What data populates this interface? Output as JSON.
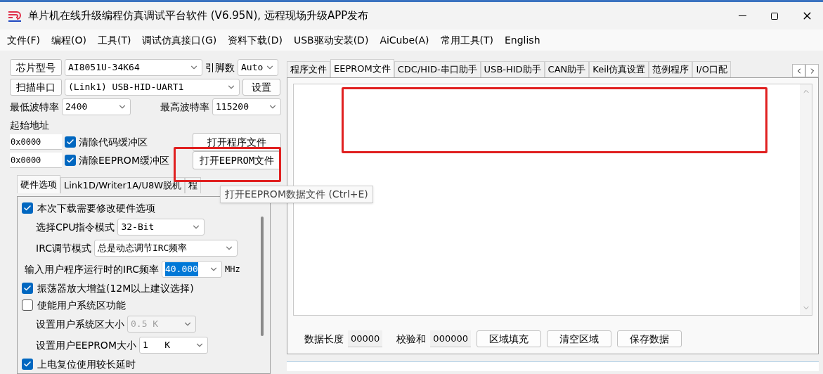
{
  "window": {
    "title": "单片机在线升级编程仿真调试平台软件 (V6.95N), 远程现场升级APP发布"
  },
  "menu": [
    "文件(F)",
    "编程(O)",
    "工具(T)",
    "调试仿真接口(G)",
    "资料下载(D)",
    "USB驱动安装(D)",
    "AiCube(A)",
    "常用工具(T)",
    "English"
  ],
  "chip": {
    "button": "芯片型号",
    "value": "AI8051U-34K64",
    "pins_label": "引脚数",
    "pins_value": "Auto"
  },
  "port": {
    "button": "扫描串口",
    "value": "(Link1) USB-HID-UART1",
    "settings_button": "设置"
  },
  "baud": {
    "min_label": "最低波特率",
    "min_value": "2400",
    "max_label": "最高波特率",
    "max_value": "115200"
  },
  "address": {
    "label": "起始地址",
    "rows": [
      {
        "value": "0x0000",
        "checkbox_label": "清除代码缓冲区",
        "checked": true,
        "button": "打开程序文件"
      },
      {
        "value": "0x0000",
        "checkbox_label": "清除EEPROM缓冲区",
        "checked": true,
        "button": "打开EEPROM文件"
      }
    ]
  },
  "left_tabs": [
    {
      "label": "硬件选项",
      "selected": true
    },
    {
      "label": "Link1D/Writer1A/U8W脱机",
      "selected": false
    },
    {
      "label": "程",
      "selected": false
    }
  ],
  "tooltip": "打开EEPROM数据文件 (Ctrl+E)",
  "hardware_options": [
    {
      "kind": "checkbox",
      "label": "本次下载需要修改硬件选项",
      "checked": true
    },
    {
      "kind": "select",
      "label": "选择CPU指令模式",
      "value": "32-Bit",
      "disabled": false
    },
    {
      "kind": "select",
      "label": "IRC调节模式",
      "value": "总是动态调节IRC频率",
      "disabled": false
    },
    {
      "kind": "freq",
      "label": "输入用户程序运行时的IRC频率",
      "value": "40.000",
      "text_selected": true,
      "unit": "MHz"
    },
    {
      "kind": "checkbox",
      "label": "振荡器放大增益(12M以上建议选择)",
      "checked": true
    },
    {
      "kind": "checkbox",
      "label": "使能用户系统区功能",
      "checked": false
    },
    {
      "kind": "select",
      "label": "设置用户系统区大小",
      "value": "0.5 K",
      "disabled": true
    },
    {
      "kind": "select",
      "label": "设置用户EEPROM大小",
      "value": "1   K",
      "disabled": false
    },
    {
      "kind": "checkbox",
      "label": "上电复位使用较长延时",
      "checked": true
    }
  ],
  "right_tabs": [
    {
      "label": "程序文件",
      "selected": false
    },
    {
      "label": "EEPROM文件",
      "selected": true
    },
    {
      "label": "CDC/HID-串口助手",
      "selected": false
    },
    {
      "label": "USB-HID助手",
      "selected": false
    },
    {
      "label": "CAN助手",
      "selected": false
    },
    {
      "label": "Keil仿真设置",
      "selected": false
    },
    {
      "label": "范例程序",
      "selected": false
    },
    {
      "label": "I/O口配",
      "selected": false
    }
  ],
  "footer": {
    "length_label": "数据长度",
    "length_value": "00000",
    "checksum_label": "校验和",
    "checksum_value": "000000",
    "buttons": [
      "区域填充",
      "清空区域",
      "保存数据"
    ]
  }
}
